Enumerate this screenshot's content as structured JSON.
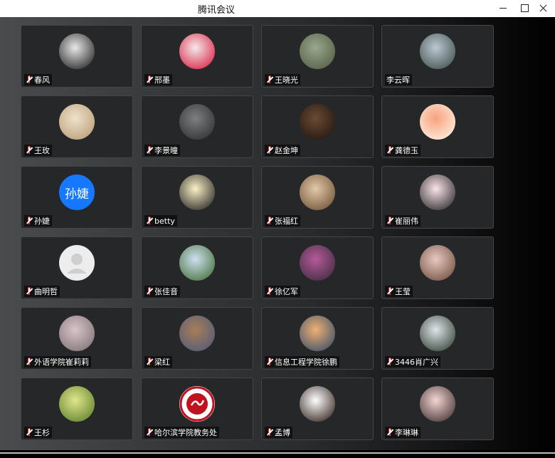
{
  "window": {
    "title": "腾讯会议"
  },
  "participants": [
    {
      "name": "春风",
      "muted": true,
      "avatar": {
        "kind": "photo",
        "colors": [
          "#e8e8e8",
          "#1a1a1a"
        ]
      }
    },
    {
      "name": "邢墨",
      "muted": true,
      "avatar": {
        "kind": "photo",
        "colors": [
          "#f4e9ea",
          "#d8163a"
        ]
      }
    },
    {
      "name": "王晓光",
      "muted": true,
      "avatar": {
        "kind": "photo",
        "colors": [
          "#9aa78f",
          "#4f5b3f"
        ]
      }
    },
    {
      "name": "李云晖",
      "muted": false,
      "avatar": {
        "kind": "photo",
        "colors": [
          "#bcc8d4",
          "#3b4a44"
        ]
      }
    },
    {
      "name": "王玫",
      "muted": true,
      "avatar": {
        "kind": "photo",
        "colors": [
          "#efe2cc",
          "#b89b73"
        ]
      }
    },
    {
      "name": "李景曈",
      "muted": true,
      "avatar": {
        "kind": "photo",
        "colors": [
          "#7d7f81",
          "#2a2c2e"
        ]
      }
    },
    {
      "name": "赵金坤",
      "muted": true,
      "avatar": {
        "kind": "photo",
        "colors": [
          "#6a4a34",
          "#1e140e"
        ]
      }
    },
    {
      "name": "龚德玉",
      "muted": true,
      "avatar": {
        "kind": "photo",
        "colors": [
          "#f7a37d",
          "#fff4e8"
        ]
      }
    },
    {
      "name": "孙婕",
      "muted": true,
      "avatar": {
        "kind": "text",
        "text": "孙婕",
        "colors": [
          "#1677ff",
          "#1677ff"
        ]
      }
    },
    {
      "name": "betty",
      "muted": true,
      "avatar": {
        "kind": "photo",
        "colors": [
          "#fbf0c6",
          "#1b1b1b"
        ]
      }
    },
    {
      "name": "张福红",
      "muted": true,
      "avatar": {
        "kind": "photo",
        "colors": [
          "#e2c9a6",
          "#6a4c33"
        ]
      }
    },
    {
      "name": "崔丽伟",
      "muted": true,
      "avatar": {
        "kind": "photo",
        "colors": [
          "#fbe4ea",
          "#222222"
        ]
      }
    },
    {
      "name": "曲明哲",
      "muted": true,
      "avatar": {
        "kind": "default",
        "colors": [
          "#ededed",
          "#cfcfcf"
        ]
      }
    },
    {
      "name": "张佳音",
      "muted": true,
      "avatar": {
        "kind": "photo",
        "colors": [
          "#cfe0ef",
          "#3f6a32"
        ]
      }
    },
    {
      "name": "徐亿军",
      "muted": true,
      "avatar": {
        "kind": "photo",
        "colors": [
          "#b45a9a",
          "#3a2a3a"
        ]
      }
    },
    {
      "name": "王莹",
      "muted": true,
      "avatar": {
        "kind": "photo",
        "colors": [
          "#e9c8c2",
          "#6b4a3a"
        ]
      }
    },
    {
      "name": "外语学院崔莉莉",
      "muted": true,
      "avatar": {
        "kind": "photo",
        "colors": [
          "#d9c4c9",
          "#7a6f72"
        ]
      }
    },
    {
      "name": "梁红",
      "muted": true,
      "avatar": {
        "kind": "photo",
        "colors": [
          "#a87d5a",
          "#4b5a78"
        ]
      }
    },
    {
      "name": "信息工程学院徐鹏",
      "muted": true,
      "avatar": {
        "kind": "photo",
        "colors": [
          "#f1b073",
          "#2e4a6a"
        ]
      }
    },
    {
      "name": "3446肖广兴",
      "muted": true,
      "avatar": {
        "kind": "photo",
        "colors": [
          "#dfe4ea",
          "#2a3a2a"
        ]
      }
    },
    {
      "name": "王杉",
      "muted": true,
      "avatar": {
        "kind": "photo",
        "colors": [
          "#dfe78a",
          "#5a7a2a"
        ]
      }
    },
    {
      "name": "哈尔滨学院教务处",
      "muted": true,
      "avatar": {
        "kind": "logo",
        "colors": [
          "#ffffff",
          "#c1121f"
        ]
      }
    },
    {
      "name": "孟博",
      "muted": true,
      "avatar": {
        "kind": "photo",
        "colors": [
          "#ffffff",
          "#2a1a14"
        ]
      }
    },
    {
      "name": "李琳琳",
      "muted": true,
      "avatar": {
        "kind": "photo",
        "colors": [
          "#f3d6d4",
          "#3a2a2a"
        ]
      }
    }
  ]
}
